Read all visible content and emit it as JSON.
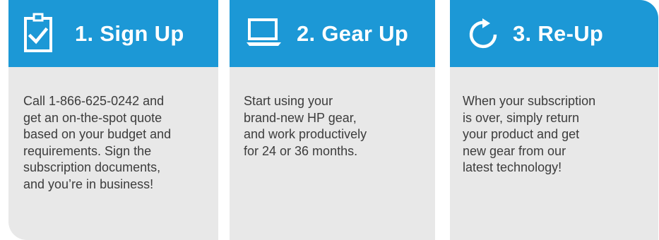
{
  "steps": [
    {
      "title": "1. Sign Up",
      "icon": "clipboard-check-icon",
      "body": [
        "Call 1-866-625-0242 and",
        "get an on-the-spot quote",
        "based on your budget and",
        "requirements. Sign the",
        "subscription documents,",
        "and you’re in business!"
      ]
    },
    {
      "title": "2. Gear Up",
      "icon": "laptop-icon",
      "body": [
        "Start using your",
        "brand-new HP gear,",
        "and work productively",
        "for 24 or 36 months."
      ]
    },
    {
      "title": "3. Re-Up",
      "icon": "refresh-icon",
      "body": [
        "When your subscription",
        "is over, simply return",
        "your product and get",
        "new gear from our",
        "latest technology!"
      ]
    }
  ],
  "colors": {
    "header_blue": "#1c98d6",
    "card_gray": "#e8e8e8",
    "body_text": "#3c3c3c",
    "header_text": "#ffffff"
  }
}
